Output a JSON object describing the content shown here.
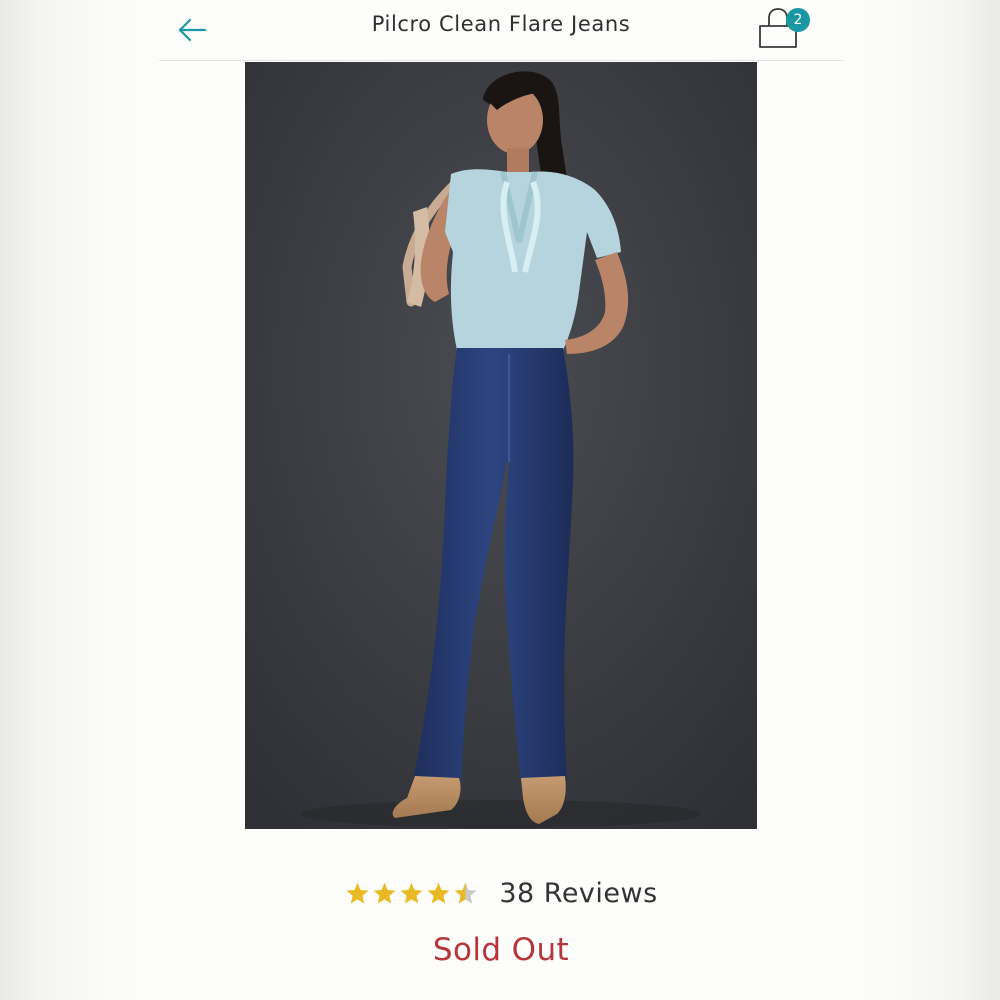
{
  "header": {
    "title": "Pilcro Clean Flare Jeans",
    "back_icon": "arrow-left-icon",
    "cart_icon": "shopping-bag-icon",
    "cart_count": "2"
  },
  "product": {
    "image_alt": "Model wearing flare jeans with a light blue ruffled top and tan boots"
  },
  "rating": {
    "stars_value": 4.5,
    "stars_max": 5,
    "reviews_label": "38 Reviews"
  },
  "availability": {
    "status": "Sold Out"
  },
  "colors": {
    "accent": "#1a98a3",
    "star": "#e8b923",
    "sold_out": "#b6363c"
  }
}
